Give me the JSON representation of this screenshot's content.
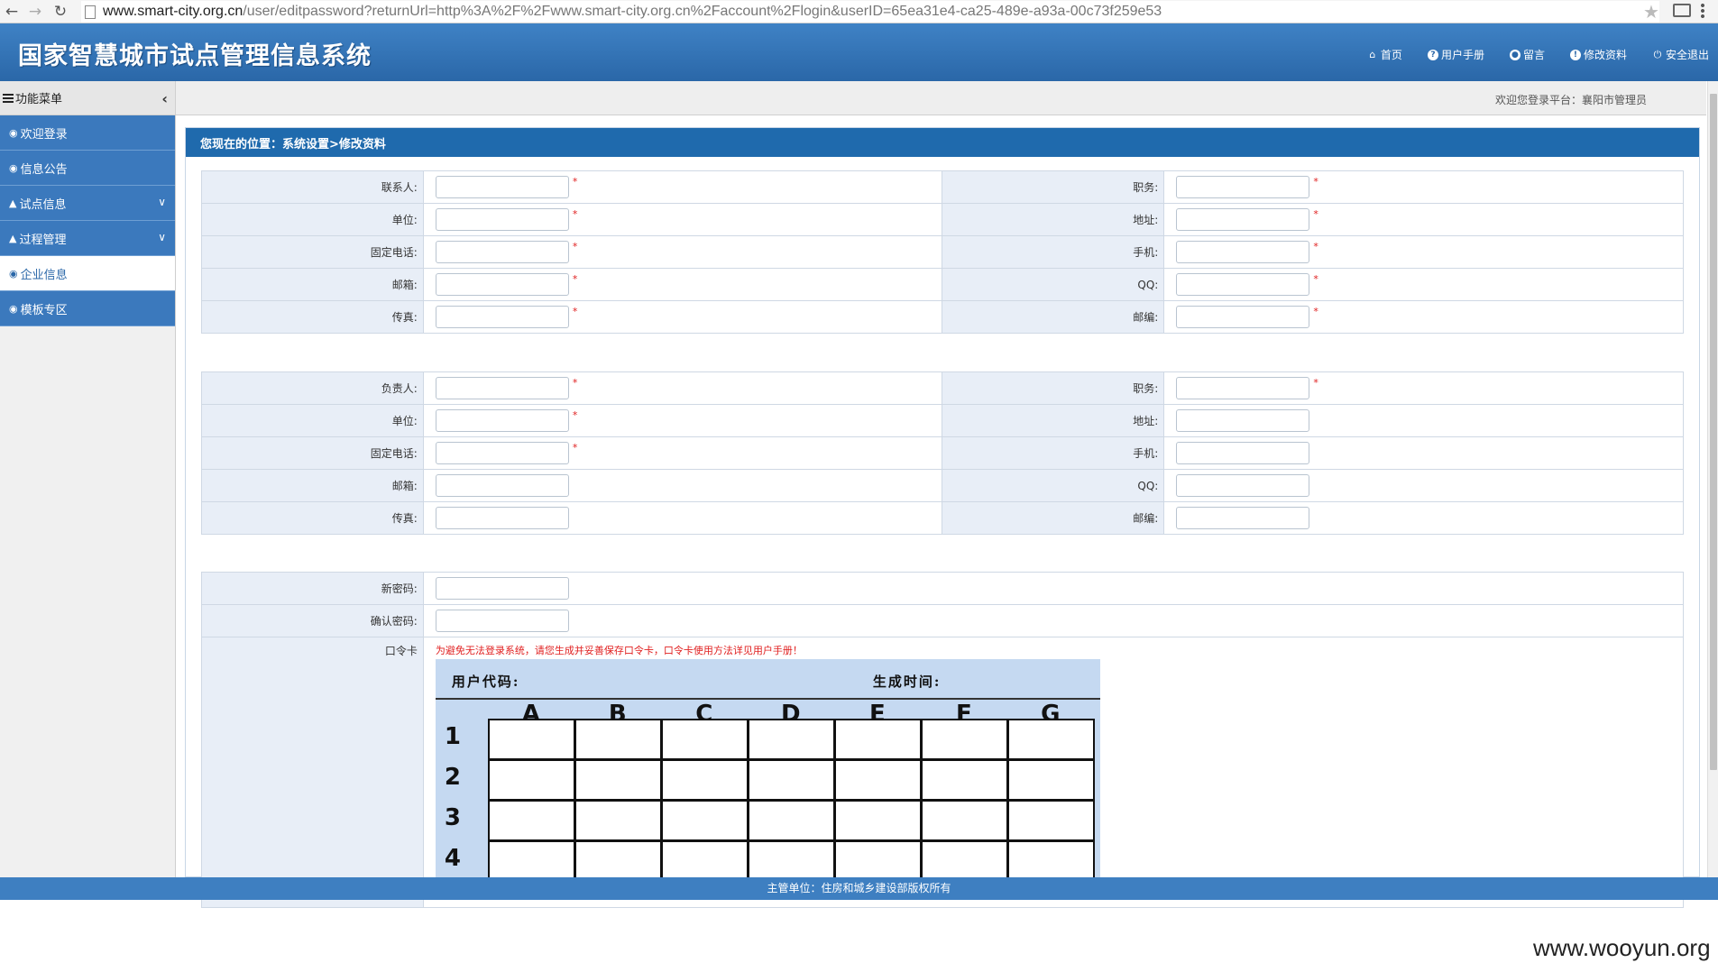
{
  "browser": {
    "url_host": "www.smart-city.org.cn",
    "url_path": "/user/editpassword?returnUrl=http%3A%2F%2Fwww.smart-city.org.cn%2Faccount%2Flogin&userID=65ea31e4-ca25-489e-a93a-00c73f259e53"
  },
  "header": {
    "title": "国家智慧城市试点管理信息系统",
    "links": [
      "首页",
      "用户手册",
      "留言",
      "修改资料",
      "安全退出"
    ]
  },
  "welcome": "欢迎您登录平台：襄阳市管理员",
  "sidebar": {
    "title": "功能菜单",
    "items": [
      {
        "label": "欢迎登录"
      },
      {
        "label": "信息公告"
      },
      {
        "label": "试点信息"
      },
      {
        "label": "过程管理"
      },
      {
        "label": "企业信息"
      },
      {
        "label": "模板专区"
      }
    ]
  },
  "breadcrumb": "您现在的位置：系统设置>修改资料",
  "contact_section": {
    "left_labels": [
      "联系人:",
      "单位:",
      "固定电话:",
      "邮箱:",
      "传真:"
    ],
    "right_labels": [
      "职务:",
      "地址:",
      "手机:",
      "QQ:",
      "邮编:"
    ]
  },
  "leader_section": {
    "left_labels": [
      "负责人:",
      "单位:",
      "固定电话:",
      "邮箱:",
      "传真:"
    ],
    "right_labels": [
      "职务:",
      "地址:",
      "手机:",
      "QQ:",
      "邮编:"
    ]
  },
  "password_section": {
    "new_password_label": "新密码:",
    "confirm_password_label": "确认密码:",
    "token_label": "口令卡",
    "token_note": "为避免无法登录系统，请您生成并妥善保存口令卡，口令卡使用方法详见用户手册！"
  },
  "token_card": {
    "user_code_label": "用户代码:",
    "generated_time_label": "生成时间:",
    "columns": [
      "A",
      "B",
      "C",
      "D",
      "E",
      "F",
      "G"
    ],
    "rows": [
      "1",
      "2",
      "3",
      "4"
    ]
  },
  "required_mark": "*",
  "footer": "主管单位：住房和城乡建设部版权所有",
  "watermark": "www.wooyun.org"
}
